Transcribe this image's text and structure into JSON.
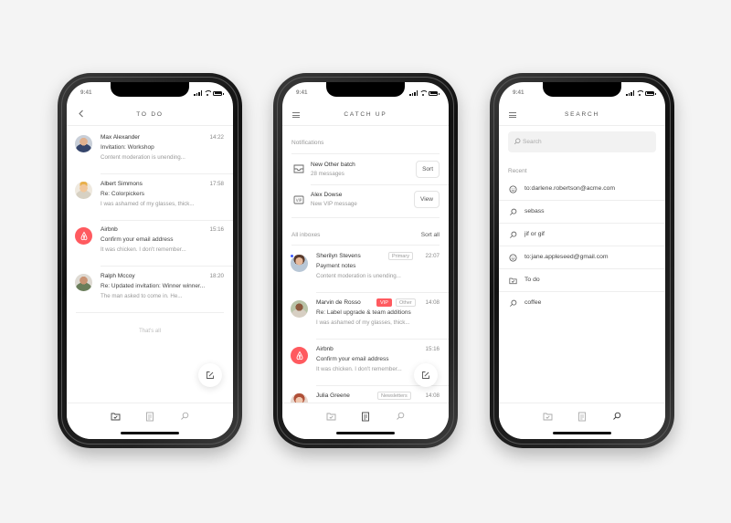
{
  "status": {
    "time": "9:41"
  },
  "todo": {
    "title": "TO DO",
    "items": [
      {
        "name": "Max Alexander",
        "time": "14:22",
        "subject": "Invitation: Workshop",
        "preview": "Content moderation is unending..."
      },
      {
        "name": "Albert Simmons",
        "time": "17:58",
        "subject": "Re: Colorpickers",
        "preview": "I was ashamed of my glasses, thick..."
      },
      {
        "name": "Airbnb",
        "time": "15:16",
        "subject": "Confirm your email address",
        "preview": "It was chicken. I don't remember..."
      },
      {
        "name": "Ralph Mccoy",
        "time": "18:20",
        "subject": "Re: Updated invitation: Winner winner...",
        "preview": "The man asked to come in. He..."
      }
    ],
    "end_text": "That's all"
  },
  "catchup": {
    "title": "CATCH UP",
    "notifications_label": "Notifications",
    "notifications": [
      {
        "title": "New Other batch",
        "subtitle": "28 messages",
        "button": "Sort",
        "icon": "inbox-tray-icon"
      },
      {
        "title": "Alex Dowse",
        "subtitle": "New VIP message",
        "button": "View",
        "icon": "vip-icon"
      }
    ],
    "inboxes_label": "All inboxes",
    "sort_all": "Sort all",
    "items": [
      {
        "name": "Sherilyn Stevens",
        "tag": "Primary",
        "time": "22:07",
        "subject": "Payment notes",
        "preview": "Content moderation is unending..."
      },
      {
        "name": "Marvin de Rosso",
        "tag_vip": "VIP",
        "tag": "Other",
        "time": "14:08",
        "subject": "Re: Label upgrade & team additions",
        "preview": "I was ashamed of my glasses, thick..."
      },
      {
        "name": "Airbnb",
        "time": "15:16",
        "subject": "Confirm your email address",
        "preview": "It was chicken. I don't remember..."
      },
      {
        "name": "Julia Greene",
        "tag": "Newsletters",
        "time": "14:08"
      }
    ]
  },
  "search": {
    "title": "SEARCH",
    "placeholder": "Search",
    "recent_label": "Recent",
    "recent": [
      {
        "text": "to:darlene.robertson@acme.com",
        "icon": "contact-icon"
      },
      {
        "text": "sebass",
        "icon": "search-icon"
      },
      {
        "text": "jif or gif",
        "icon": "search-icon"
      },
      {
        "text": "to:jane.appleseed@gmail.com",
        "icon": "contact-icon"
      },
      {
        "text": "To do",
        "icon": "folder-check-icon"
      },
      {
        "text": "coffee",
        "icon": "search-icon"
      }
    ]
  },
  "colors": {
    "accent": "#ff5a5f",
    "badge": "#3d5afe"
  }
}
